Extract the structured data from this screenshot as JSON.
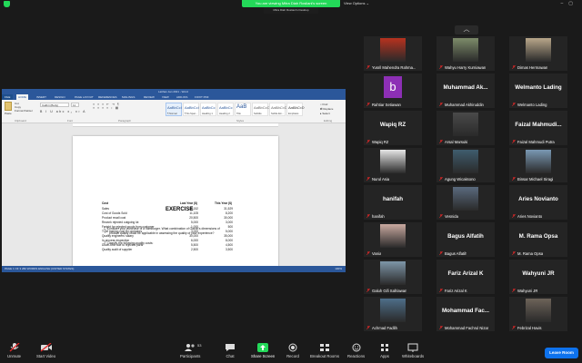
{
  "top": {
    "share_banner": "You are viewing Mitra Diah Rosliani's screen",
    "view_options": "View Options",
    "pip_label": "Mitra Diah Rosliani's Desktop"
  },
  "word": {
    "title": "Latihan Jan 2021 - Word",
    "tabs": [
      "FILE",
      "HOME",
      "INSERT",
      "DESIGN",
      "PAGE LAYOUT",
      "REFERENCES",
      "MAILINGS",
      "REVIEW",
      "VIEW",
      "ADD-INS",
      "FOXIT PDF"
    ],
    "clipboard": {
      "paste": "Paste",
      "cut": "Cut",
      "copy": "Copy",
      "format_painter": "Format Painter",
      "group": "Clipboard"
    },
    "font": {
      "name": "Calibri (Body)",
      "size": "11",
      "group": "Font"
    },
    "paragraph_group": "Paragraph",
    "styles": [
      {
        "sample": "AaBbCcI",
        "name": "¶ Normal"
      },
      {
        "sample": "AaBbCcI",
        "name": "¶ No Spac..."
      },
      {
        "sample": "AaBbCc",
        "name": "Heading 1"
      },
      {
        "sample": "AaBbCc",
        "name": "Heading 2"
      },
      {
        "sample": "AaB",
        "name": "Title"
      },
      {
        "sample": "AaBbCcC",
        "name": "Subtitle"
      },
      {
        "sample": "AaBbCcD",
        "name": "Subtle Em..."
      },
      {
        "sample": "AaBbCcD",
        "name": "Emphasis"
      }
    ],
    "styles_group": "Styles",
    "editing": {
      "find": "Find",
      "replace": "Replace",
      "select": "Select",
      "group": "Editing"
    },
    "status_left": "PAGE 1 OF 3   282 WORDS   ENGLISH (UNITED STATES)",
    "status_right": "100%"
  },
  "document": {
    "title": "EXERCISE",
    "q1_line1": "1.   Consider your purchase of a hamburger.  What combination of Garvin's dimensions of",
    "q1_line2": "product quality could be applicable in assessing the quality of your experience?",
    "q2": "2.   Classify the following quality costs:",
    "table": {
      "headers": [
        "Cost",
        "Last Year ($)",
        "This Year ($)"
      ],
      "rows": [
        [
          "Sales",
          "25,152",
          "31,529"
        ],
        [
          "Cost of Goods Sold",
          "11,105",
          "8,200"
        ],
        [
          "Product recall cost",
          "20,500",
          "30,000"
        ],
        [
          "Rework rejected outgoing lot",
          "5,000",
          "3,000"
        ],
        [
          "Freight for rejected goods from customer",
          "1,000",
          "500"
        ],
        [
          "TQM training cost for operators",
          "3,000",
          "5,000"
        ],
        [
          "Quality engineers' salary",
          "30,000",
          "35,000"
        ],
        [
          "In-process inspection",
          "6,000",
          "8,000"
        ],
        [
          "Down-time due to rejected parts",
          "5,500",
          "4,500"
        ],
        [
          "Quality audit of supplier",
          "2,500",
          "3,500"
        ]
      ]
    }
  },
  "participants": [
    {
      "name": "Yusril Mahendra Rahma...",
      "type": "photo",
      "color": "#b8321f"
    },
    {
      "name": "Wahyu Harry Kurniawan",
      "type": "photo",
      "color": "#7d8c6a"
    },
    {
      "name": "Dimas Hermawan",
      "type": "photo",
      "color": "#b9a78a"
    },
    {
      "name": "Rahtiar Setiawan",
      "type": "avatar",
      "letter": "b",
      "color": "#8d2fb5"
    },
    {
      "name": "Muhammad Akhiruddin",
      "type": "text",
      "big": "Muhammad Ak..."
    },
    {
      "name": "Welmanto Lading",
      "type": "text",
      "big": "Welmanto Lading"
    },
    {
      "name": "Wapiq RZ",
      "type": "text",
      "big": "Wapiq RZ"
    },
    {
      "name": "Arsal Marsuki",
      "type": "photo",
      "color": "#4a4a4a"
    },
    {
      "name": "Faizal Mahmudi Putra",
      "type": "text",
      "big": "Faizal Mahmudi..."
    },
    {
      "name": "Nurul Asia",
      "type": "photo",
      "color": "#e6e6e6"
    },
    {
      "name": "Agung Wicaksono",
      "type": "photo",
      "color": "#3f5d6e"
    },
    {
      "name": "Binsar Michael Siragi",
      "type": "photo",
      "color": "#7a99b4"
    },
    {
      "name": "hanifah",
      "type": "text",
      "big": "hanifah"
    },
    {
      "name": "Vesnida",
      "type": "photo",
      "color": "#5a6a7e"
    },
    {
      "name": "Aries Novianto",
      "type": "text",
      "big": "Aries Novianto"
    },
    {
      "name": "Vania",
      "type": "photo",
      "color": "#c9a9a0"
    },
    {
      "name": "Bagus Alfatih",
      "type": "text",
      "big": "Bagus Alfatih"
    },
    {
      "name": "M. Rama Opsa",
      "type": "text",
      "big": "M. Rama Opsa"
    },
    {
      "name": "Galuh Gifi Safriawan",
      "type": "photo",
      "color": "#7e96a8"
    },
    {
      "name": "Fariz Arizal K",
      "type": "text",
      "big": "Fariz Arizal K"
    },
    {
      "name": "Wahyuni JR",
      "type": "text",
      "big": "Wahyuni JR"
    },
    {
      "name": "Achmad Fadlih",
      "type": "photo",
      "color": "#4e6e89"
    },
    {
      "name": "Mohammad Fachrul Nizar",
      "type": "text",
      "big": "Mohammad Fac..."
    },
    {
      "name": "Febrizal Havis",
      "type": "photo",
      "color": "#6d6359"
    }
  ],
  "toolbar": {
    "unmute": "Unmute",
    "start_video": "Start Video",
    "participants": "Participants",
    "participant_count": "53",
    "chat": "Chat",
    "share_screen": "Share Screen",
    "record": "Record",
    "breakout": "Breakout Rooms",
    "reactions": "Reactions",
    "apps": "Apps",
    "whiteboards": "Whiteboards",
    "leave": "Leave Room"
  },
  "colors": {
    "zoom_green": "#23d959",
    "zoom_blue": "#0e72ed",
    "word_blue": "#2b579a",
    "mute_red": "#e02828"
  }
}
